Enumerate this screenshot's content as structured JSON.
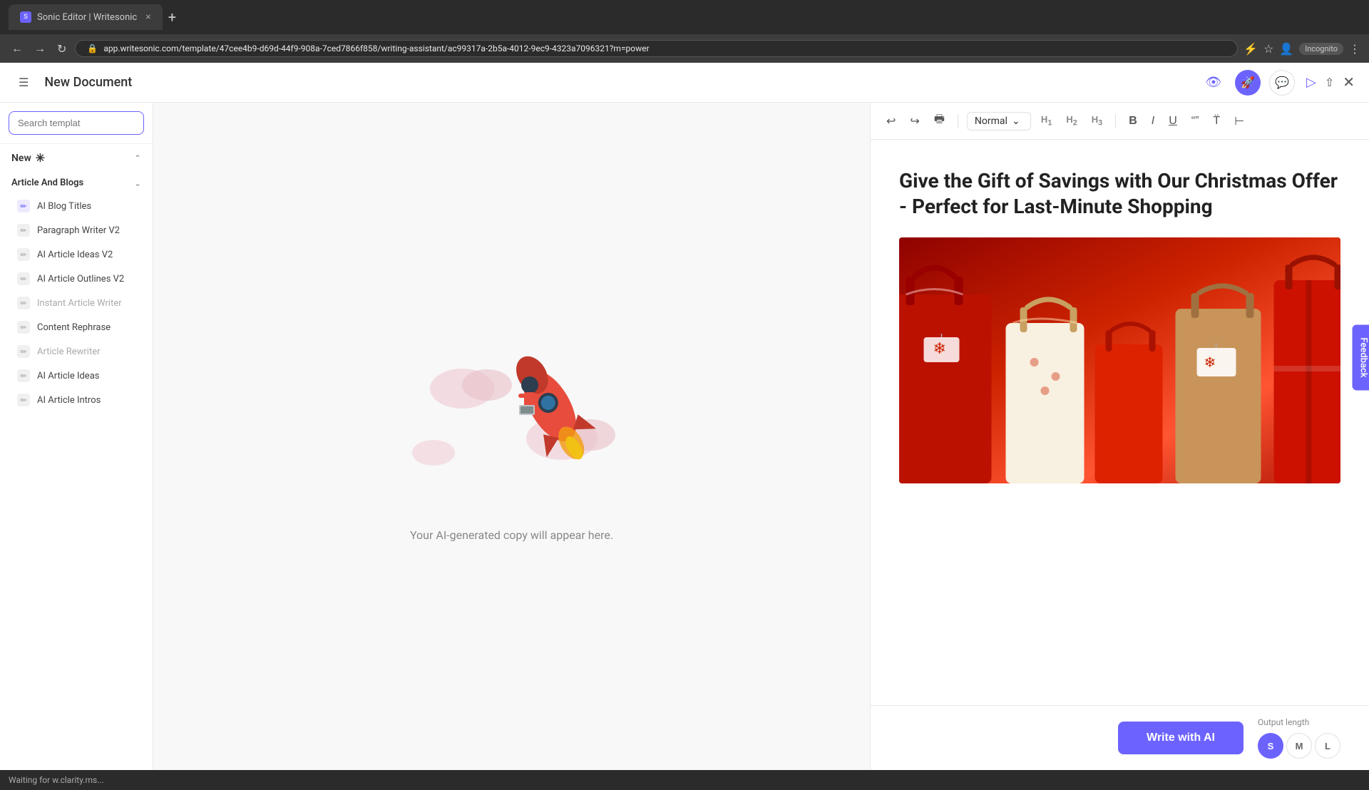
{
  "browser": {
    "tab_title": "Sonic Editor | Writesonic",
    "url": "app.writesonic.com/template/47cee4b9-d69d-44f9-908a-7ced7866f858/writing-assistant/ac99317a-2b5a-4012-9ec9-4323a7096321?m=power",
    "incognito_label": "Incognito"
  },
  "header": {
    "menu_label": "☰",
    "title": "New Document",
    "close_label": "×"
  },
  "sidebar": {
    "search_placeholder": "Search templat",
    "new_section": "New",
    "sparkle": "✳",
    "article_section": "Article And Blogs",
    "items": [
      {
        "label": "AI Blog Titles",
        "icon_type": "purple",
        "disabled": false
      },
      {
        "label": "Paragraph Writer V2",
        "icon_type": "gray",
        "disabled": false
      },
      {
        "label": "AI Article Ideas V2",
        "icon_type": "gray",
        "disabled": false
      },
      {
        "label": "AI Article Outlines V2",
        "icon_type": "gray",
        "disabled": false
      },
      {
        "label": "Instant Article Writer",
        "icon_type": "gray",
        "disabled": true
      },
      {
        "label": "Content Rephrase",
        "icon_type": "gray",
        "disabled": false
      },
      {
        "label": "Article Rewriter",
        "icon_type": "gray",
        "disabled": true
      },
      {
        "label": "AI Article Ideas",
        "icon_type": "gray",
        "disabled": false
      },
      {
        "label": "AI Article Intros",
        "icon_type": "gray",
        "disabled": false
      }
    ]
  },
  "toolbar": {
    "undo_label": "↩",
    "redo_label": "↪",
    "style_label": "Normal",
    "h1_label": "H₁",
    "h2_label": "H₂",
    "h3_label": "H₃",
    "bold_label": "B",
    "italic_label": "I",
    "underline_label": "U",
    "quote_label": "\"\"",
    "format_label": "T̈",
    "align_label": "⊣"
  },
  "editor": {
    "article_title": "Give the Gift of Savings with Our Christmas Offer - Perfect for Last-Minute Shopping"
  },
  "center_panel": {
    "placeholder_text": "Your AI-generated copy will appear here."
  },
  "bottom_panel": {
    "write_ai_label": "Write with AI",
    "output_length_label": "Output length",
    "length_s": "S",
    "length_m": "M",
    "length_l": "L"
  },
  "feedback": {
    "label": "Feedback"
  },
  "status_bar": {
    "text": "Waiting for w.clarity.ms..."
  }
}
